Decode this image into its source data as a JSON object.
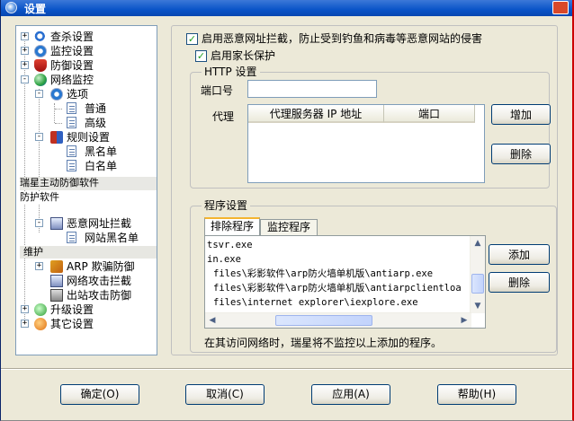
{
  "window": {
    "title": "设置"
  },
  "tree": {
    "items": [
      {
        "label": "查杀设置",
        "expander": "+"
      },
      {
        "label": "监控设置",
        "expander": "+"
      },
      {
        "label": "防御设置",
        "expander": "+"
      },
      {
        "label": "网络监控",
        "expander": "-"
      },
      {
        "label": "选项",
        "expander": "-"
      },
      {
        "label": "普通"
      },
      {
        "label": "高级"
      },
      {
        "label": "规则设置",
        "expander": "-"
      },
      {
        "label": "黑名单"
      },
      {
        "label": "白名单"
      },
      {
        "label": "恶意网址拦截"
      },
      {
        "label": "网站黑名单"
      },
      {
        "label": "ARP 欺骗防御",
        "expander": "+"
      },
      {
        "label": "网络攻击拦截"
      },
      {
        "label": "出站攻击防御"
      },
      {
        "label": "升级设置",
        "expander": "+"
      },
      {
        "label": "其它设置",
        "expander": "+"
      }
    ],
    "overlay_texts": [
      "瑞星主动防御软件",
      "防护软件",
      "维护"
    ]
  },
  "settings": {
    "enable_malicious_url_block": {
      "label": "启用恶意网址拦截，防止受到钓鱼和病毒等恶意网站的侵害",
      "checked": true,
      "mark": "✓"
    },
    "enable_parental_control": {
      "label": "启用家长保护",
      "checked": true,
      "mark": "✓"
    }
  },
  "http": {
    "group_title": "HTTP 设置",
    "port_label": "端口号",
    "port_value": "",
    "proxy_label": "代理",
    "columns": [
      "代理服务器 IP 地址",
      "端口"
    ],
    "add_label": "增加",
    "delete_label": "删除"
  },
  "program": {
    "group_title": "程序设置",
    "tabs": [
      "排除程序",
      "监控程序"
    ],
    "items": [
      "tsvr.exe",
      "in.exe",
      "files\\彩影软件\\arp防火墙单机版\\antiarp.exe",
      "files\\彩影软件\\arp防火墙单机版\\antiarpclientloa",
      "files\\internet explorer\\iexplore.exe"
    ],
    "add_label": "添加",
    "delete_label": "删除",
    "note": "在其访问网络时，瑞星将不监控以上添加的程序。"
  },
  "footer": {
    "ok_label": "确定(O)",
    "cancel_label": "取消(C)",
    "apply_label": "应用(A)",
    "help_label": "帮助(H)"
  },
  "colors": {
    "titlebar": "#0a54c8",
    "check": "#21a121",
    "window_bg": "#ece9d8"
  }
}
